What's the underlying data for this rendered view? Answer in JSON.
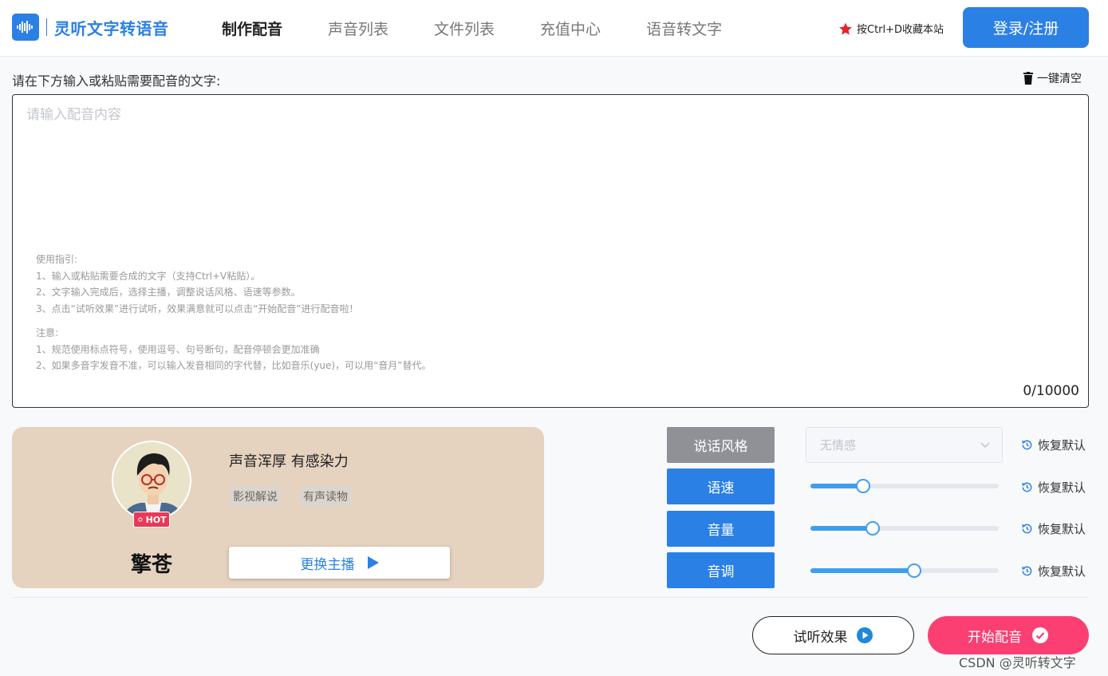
{
  "header": {
    "logo_text": "灵听文字转语音",
    "nav": [
      {
        "label": "制作配音",
        "active": true
      },
      {
        "label": "声音列表",
        "active": false
      },
      {
        "label": "文件列表",
        "active": false
      },
      {
        "label": "充值中心",
        "active": false
      },
      {
        "label": "语音转文字",
        "active": false
      }
    ],
    "favorite_hint": "按Ctrl+D收藏本站",
    "login_label": "登录/注册"
  },
  "editor": {
    "prompt": "请在下方输入或粘贴需要配音的文字:",
    "clear_label": "一键清空",
    "placeholder": "请输入配音内容",
    "value": "",
    "guide_title": "使用指引:",
    "guide_lines": [
      "1、输入或粘贴需要合成的文字（支持Ctrl+V粘贴）。",
      "2、文字输入完成后，选择主播，调整说话风格、语速等参数。",
      "3、点击“试听效果”进行试听，效果满意就可以点击“开始配音”进行配音啦！"
    ],
    "note_title": "注意:",
    "note_lines": [
      "1、规范使用标点符号，使用逗号、句号断句，配音停顿会更加准确",
      "2、如果多音字发音不准，可以输入发音相同的字代替，比如音乐(yue)，可以用“音月”替代。"
    ],
    "counter": "0/10000"
  },
  "anchor": {
    "hot_badge": "HOT",
    "name": "擎苍",
    "description": "声音浑厚 有感染力",
    "tags": [
      "影视解说",
      "有声读物"
    ],
    "change_label": "更换主播"
  },
  "controls": {
    "style": {
      "label": "说话风格",
      "value": "无情感",
      "reset": "恢复默认"
    },
    "speed": {
      "label": "语速",
      "level": 0.28,
      "reset": "恢复默认"
    },
    "volume": {
      "label": "音量",
      "level": 0.33,
      "reset": "恢复默认"
    },
    "pitch": {
      "label": "音调",
      "level": 0.55,
      "reset": "恢复默认"
    }
  },
  "actions": {
    "preview_label": "试听效果",
    "start_label": "开始配音"
  },
  "watermark": "CSDN @灵听转文字",
  "colors": {
    "accent": "#2b80e6",
    "start": "#fb3f73",
    "card": "#e5d3bf"
  }
}
